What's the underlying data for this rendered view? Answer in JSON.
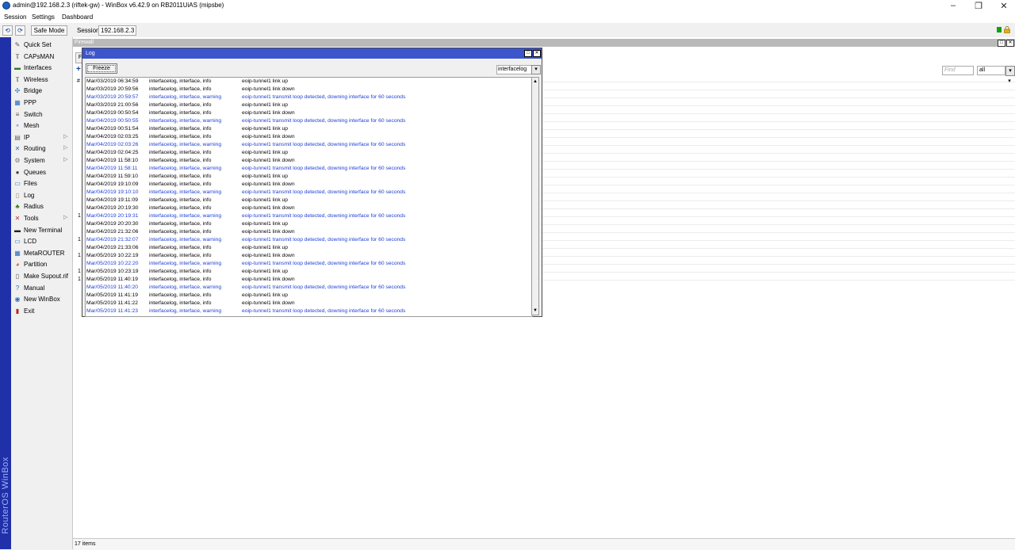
{
  "window": {
    "title": "admin@192.168.2.3 (riftek-gw) - WinBox v6.42.9 on RB2011UiAS (mipsbe)"
  },
  "menu": [
    "Session",
    "Settings",
    "Dashboard"
  ],
  "toolbar": {
    "safe_mode": "Safe Mode",
    "session_label": "Session:",
    "session_value": "192.168.2.3"
  },
  "branding": "RouterOS WinBox",
  "sidebar": [
    {
      "label": "Quick Set",
      "icon": "quick-set-icon",
      "sub": false
    },
    {
      "label": "CAPsMAN",
      "icon": "capsman-icon",
      "sub": false
    },
    {
      "label": "Interfaces",
      "icon": "interfaces-icon",
      "sub": false
    },
    {
      "label": "Wireless",
      "icon": "wireless-icon",
      "sub": false
    },
    {
      "label": "Bridge",
      "icon": "bridge-icon",
      "sub": false
    },
    {
      "label": "PPP",
      "icon": "ppp-icon",
      "sub": false
    },
    {
      "label": "Switch",
      "icon": "switch-icon",
      "sub": false
    },
    {
      "label": "Mesh",
      "icon": "mesh-icon",
      "sub": false
    },
    {
      "label": "IP",
      "icon": "ip-icon",
      "sub": true
    },
    {
      "label": "Routing",
      "icon": "routing-icon",
      "sub": true
    },
    {
      "label": "System",
      "icon": "system-icon",
      "sub": true
    },
    {
      "label": "Queues",
      "icon": "queues-icon",
      "sub": false
    },
    {
      "label": "Files",
      "icon": "files-icon",
      "sub": false
    },
    {
      "label": "Log",
      "icon": "log-icon",
      "sub": false
    },
    {
      "label": "Radius",
      "icon": "radius-icon",
      "sub": false
    },
    {
      "label": "Tools",
      "icon": "tools-icon",
      "sub": true
    },
    {
      "label": "New Terminal",
      "icon": "terminal-icon",
      "sub": false
    },
    {
      "label": "LCD",
      "icon": "lcd-icon",
      "sub": false
    },
    {
      "label": "MetaROUTER",
      "icon": "metarouter-icon",
      "sub": false
    },
    {
      "label": "Partition",
      "icon": "partition-icon",
      "sub": false
    },
    {
      "label": "Make Supout.rif",
      "icon": "supout-icon",
      "sub": false
    },
    {
      "label": "Manual",
      "icon": "manual-icon",
      "sub": false
    },
    {
      "label": "New WinBox",
      "icon": "winbox-icon",
      "sub": false
    },
    {
      "label": "Exit",
      "icon": "exit-icon",
      "sub": false
    }
  ],
  "firewall": {
    "title": "Firewall",
    "find_placeholder": "Find",
    "filter_value": "all",
    "tab": "F",
    "col_hash": "#",
    "status": "17 items"
  },
  "log": {
    "title": "Log",
    "freeze_label": "Freeze",
    "topic_filter": "interfacelog",
    "rows": [
      {
        "time": "Mar/03/2019 06:34:59",
        "topics": "interfacelog, interface, info",
        "message": "eoip-tunnel1 link up",
        "level": "info"
      },
      {
        "time": "Mar/03/2019 20:59:56",
        "topics": "interfacelog, interface, info",
        "message": "eoip-tunnel1 link down",
        "level": "info"
      },
      {
        "time": "Mar/03/2019 20:59:57",
        "topics": "interfacelog, interface, warning",
        "message": "eoip-tunnel1 transmit loop detected, downing interface for 60 seconds",
        "level": "warning"
      },
      {
        "time": "Mar/03/2019 21:00:56",
        "topics": "interfacelog, interface, info",
        "message": "eoip-tunnel1 link up",
        "level": "info"
      },
      {
        "time": "Mar/04/2019 00:50:54",
        "topics": "interfacelog, interface, info",
        "message": "eoip-tunnel1 link down",
        "level": "info"
      },
      {
        "time": "Mar/04/2019 00:50:55",
        "topics": "interfacelog, interface, warning",
        "message": "eoip-tunnel1 transmit loop detected, downing interface for 60 seconds",
        "level": "warning"
      },
      {
        "time": "Mar/04/2019 00:51:54",
        "topics": "interfacelog, interface, info",
        "message": "eoip-tunnel1 link up",
        "level": "info"
      },
      {
        "time": "Mar/04/2019 02:03:25",
        "topics": "interfacelog, interface, info",
        "message": "eoip-tunnel1 link down",
        "level": "info"
      },
      {
        "time": "Mar/04/2019 02:03:26",
        "topics": "interfacelog, interface, warning",
        "message": "eoip-tunnel1 transmit loop detected, downing interface for 60 seconds",
        "level": "warning"
      },
      {
        "time": "Mar/04/2019 02:04:25",
        "topics": "interfacelog, interface, info",
        "message": "eoip-tunnel1 link up",
        "level": "info"
      },
      {
        "time": "Mar/04/2019 11:58:10",
        "topics": "interfacelog, interface, info",
        "message": "eoip-tunnel1 link down",
        "level": "info"
      },
      {
        "time": "Mar/04/2019 11:58:11",
        "topics": "interfacelog, interface, warning",
        "message": "eoip-tunnel1 transmit loop detected, downing interface for 60 seconds",
        "level": "warning"
      },
      {
        "time": "Mar/04/2019 11:59:10",
        "topics": "interfacelog, interface, info",
        "message": "eoip-tunnel1 link up",
        "level": "info"
      },
      {
        "time": "Mar/04/2019 19:10:09",
        "topics": "interfacelog, interface, info",
        "message": "eoip-tunnel1 link down",
        "level": "info"
      },
      {
        "time": "Mar/04/2019 19:10:10",
        "topics": "interfacelog, interface, warning",
        "message": "eoip-tunnel1 transmit loop detected, downing interface for 60 seconds",
        "level": "warning"
      },
      {
        "time": "Mar/04/2019 19:11:09",
        "topics": "interfacelog, interface, info",
        "message": "eoip-tunnel1 link up",
        "level": "info"
      },
      {
        "time": "Mar/04/2019 20:19:30",
        "topics": "interfacelog, interface, info",
        "message": "eoip-tunnel1 link down",
        "level": "info"
      },
      {
        "time": "Mar/04/2019 20:19:31",
        "topics": "interfacelog, interface, warning",
        "message": "eoip-tunnel1 transmit loop detected, downing interface for 60 seconds",
        "level": "warning"
      },
      {
        "time": "Mar/04/2019 20:20:30",
        "topics": "interfacelog, interface, info",
        "message": "eoip-tunnel1 link up",
        "level": "info"
      },
      {
        "time": "Mar/04/2019 21:32:06",
        "topics": "interfacelog, interface, info",
        "message": "eoip-tunnel1 link down",
        "level": "info"
      },
      {
        "time": "Mar/04/2019 21:32:07",
        "topics": "interfacelog, interface, warning",
        "message": "eoip-tunnel1 transmit loop detected, downing interface for 60 seconds",
        "level": "warning"
      },
      {
        "time": "Mar/04/2019 21:33:06",
        "topics": "interfacelog, interface, info",
        "message": "eoip-tunnel1 link up",
        "level": "info"
      },
      {
        "time": "Mar/05/2019 10:22:19",
        "topics": "interfacelog, interface, info",
        "message": "eoip-tunnel1 link down",
        "level": "info"
      },
      {
        "time": "Mar/05/2019 10:22:20",
        "topics": "interfacelog, interface, warning",
        "message": "eoip-tunnel1 transmit loop detected, downing interface for 60 seconds",
        "level": "warning"
      },
      {
        "time": "Mar/05/2019 10:23:19",
        "topics": "interfacelog, interface, info",
        "message": "eoip-tunnel1 link up",
        "level": "info"
      },
      {
        "time": "Mar/05/2019 11:40:19",
        "topics": "interfacelog, interface, info",
        "message": "eoip-tunnel1 link down",
        "level": "info"
      },
      {
        "time": "Mar/05/2019 11:40:20",
        "topics": "interfacelog, interface, warning",
        "message": "eoip-tunnel1 transmit loop detected, downing interface for 60 seconds",
        "level": "warning"
      },
      {
        "time": "Mar/05/2019 11:41:19",
        "topics": "interfacelog, interface, info",
        "message": "eoip-tunnel1 link up",
        "level": "info"
      },
      {
        "time": "Mar/05/2019 11:41:22",
        "topics": "interfacelog, interface, info",
        "message": "eoip-tunnel1 link down",
        "level": "info"
      },
      {
        "time": "Mar/05/2019 11:41:23",
        "topics": "interfacelog, interface, warning",
        "message": "eoip-tunnel1 transmit loop detected, downing interface for 60 seconds",
        "level": "warning"
      }
    ]
  },
  "colors": {
    "accent": "#3c55cc",
    "sidebar_strip": "#2030a8",
    "warning_text": "#1d3fd6"
  }
}
